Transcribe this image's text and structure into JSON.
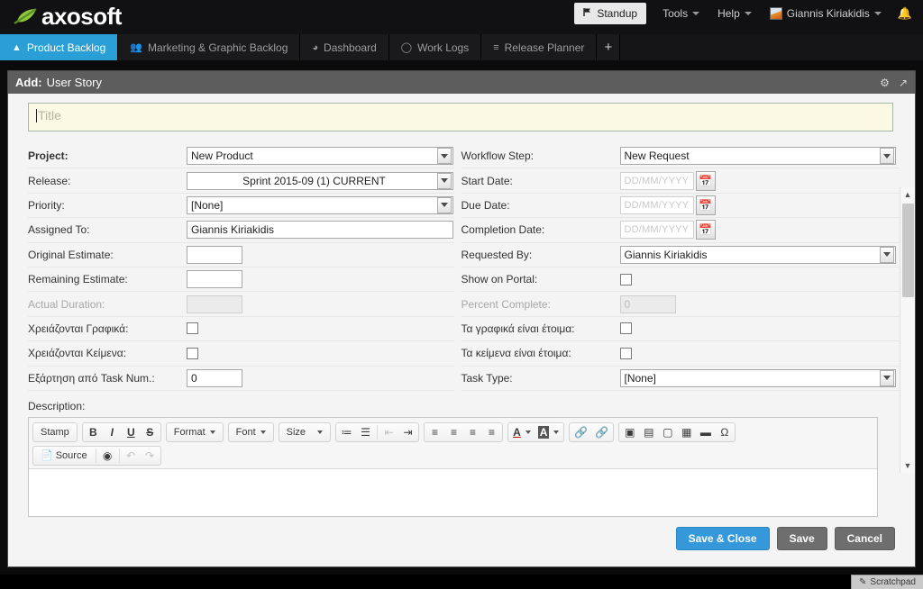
{
  "brand": {
    "name": "axosoft",
    "leaf_icon": "leaf-icon"
  },
  "topnav": {
    "standup": {
      "label": "Standup",
      "icon": "flag-icon"
    },
    "tools": {
      "label": "Tools",
      "icon": "chevron-down-icon"
    },
    "help": {
      "label": "Help",
      "icon": "chevron-down-icon"
    },
    "user": {
      "label": "Giannis Kiriakidis",
      "icon": "avatar-icon"
    },
    "notifications_icon": "bell-icon"
  },
  "tabs": [
    {
      "label": "Product Backlog",
      "icon": "people-icon",
      "active": true
    },
    {
      "label": "Marketing & Graphic Backlog",
      "icon": "people-icon",
      "active": false
    },
    {
      "label": "Dashboard",
      "icon": "gauge-icon",
      "active": false
    },
    {
      "label": "Work Logs",
      "icon": "clock-icon",
      "active": false
    },
    {
      "label": "Release Planner",
      "icon": "sliders-icon",
      "active": false
    }
  ],
  "tab_add_label": "+",
  "dialog": {
    "title_prefix": "Add:",
    "title_text": "User Story",
    "settings_icon": "gear-icon",
    "popout_icon": "popout-arrow-icon",
    "title_field": {
      "placeholder": "Title",
      "value": ""
    }
  },
  "form": {
    "left": [
      {
        "label": "Project:",
        "bold": true,
        "type": "select",
        "value": "New Product",
        "align": "left"
      },
      {
        "label": "Release:",
        "bold": false,
        "type": "select",
        "value": "Sprint 2015-09 (1) CURRENT",
        "align": "center"
      },
      {
        "label": "Priority:",
        "bold": false,
        "type": "select",
        "value": "[None]",
        "align": "left"
      },
      {
        "label": "Assigned To:",
        "bold": false,
        "type": "text-wide",
        "value": "Giannis Kiriakidis"
      },
      {
        "label": "Original Estimate:",
        "bold": false,
        "type": "text-small",
        "value": ""
      },
      {
        "label": "Remaining Estimate:",
        "bold": false,
        "type": "text-small",
        "value": ""
      },
      {
        "label": "Actual Duration:",
        "bold": false,
        "disabled": true,
        "type": "text-small-disabled",
        "value": ""
      },
      {
        "label": "Χρειάζονται Γραφικά:",
        "bold": false,
        "type": "checkbox",
        "checked": false
      },
      {
        "label": "Χρειάζονται Κείμενα:",
        "bold": false,
        "type": "checkbox",
        "checked": false
      },
      {
        "label": "Εξάρτηση από Task Num.:",
        "bold": false,
        "type": "text-small",
        "value": "0"
      }
    ],
    "right": [
      {
        "label": "Workflow Step:",
        "bold": false,
        "type": "select",
        "value": "New Request",
        "align": "left"
      },
      {
        "label": "Start Date:",
        "bold": false,
        "type": "date",
        "value": "",
        "placeholder": "DD/MM/YYYY",
        "icon": "calendar-icon"
      },
      {
        "label": "Due Date:",
        "bold": false,
        "type": "date",
        "value": "",
        "placeholder": "DD/MM/YYYY",
        "icon": "calendar-icon"
      },
      {
        "label": "Completion Date:",
        "bold": false,
        "type": "date",
        "value": "",
        "placeholder": "DD/MM/YYYY",
        "icon": "calendar-icon"
      },
      {
        "label": "Requested By:",
        "bold": false,
        "type": "select",
        "value": "Giannis Kiriakidis",
        "align": "left"
      },
      {
        "label": "Show on Portal:",
        "bold": false,
        "type": "checkbox",
        "checked": false
      },
      {
        "label": "Percent Complete:",
        "bold": false,
        "disabled": true,
        "type": "text-small-disabled",
        "value": "0"
      },
      {
        "label": "Τα γραφικά είναι έτοιμα:",
        "bold": false,
        "type": "checkbox",
        "checked": false
      },
      {
        "label": "Τα κείμενα είναι έτοιμα:",
        "bold": false,
        "type": "checkbox",
        "checked": false
      },
      {
        "label": "Task Type:",
        "bold": false,
        "type": "select",
        "value": "[None]",
        "align": "left"
      }
    ]
  },
  "description": {
    "label": "Description:",
    "body_value": "",
    "toolbar_row1": [
      {
        "name": "stamp-button",
        "label": "Stamp",
        "kind": "text",
        "disabled": false
      },
      {
        "name": "bold-button",
        "label": "B",
        "kind": "bold",
        "disabled": false
      },
      {
        "name": "italic-button",
        "label": "I",
        "kind": "italic",
        "disabled": false
      },
      {
        "name": "underline-button",
        "label": "U",
        "kind": "underline",
        "disabled": false
      },
      {
        "name": "strikethrough-button",
        "label": "S",
        "kind": "strike",
        "disabled": false
      },
      {
        "name": "format-dropdown",
        "label": "Format",
        "kind": "dropdown",
        "disabled": false
      },
      {
        "name": "font-dropdown",
        "label": "Font",
        "kind": "dropdown",
        "disabled": false
      },
      {
        "name": "size-dropdown",
        "label": "Size",
        "kind": "dropdown",
        "disabled": false
      },
      {
        "name": "numbered-list-button",
        "label": "≔",
        "kind": "icon",
        "disabled": false
      },
      {
        "name": "bulleted-list-button",
        "label": "☰",
        "kind": "icon",
        "disabled": false
      },
      {
        "name": "outdent-button",
        "label": "⇤",
        "kind": "icon",
        "disabled": true
      },
      {
        "name": "indent-button",
        "label": "⇥",
        "kind": "icon",
        "disabled": false
      },
      {
        "name": "align-left-button",
        "label": "≡",
        "kind": "icon",
        "disabled": false
      },
      {
        "name": "align-center-button",
        "label": "≡",
        "kind": "icon",
        "disabled": false
      },
      {
        "name": "align-right-button",
        "label": "≡",
        "kind": "icon",
        "disabled": false
      },
      {
        "name": "justify-button",
        "label": "≡",
        "kind": "icon",
        "disabled": false
      },
      {
        "name": "text-color-button",
        "label": "A",
        "kind": "colordrop",
        "disabled": false
      },
      {
        "name": "background-color-button",
        "label": "A",
        "kind": "colordrop2",
        "disabled": false
      },
      {
        "name": "link-button",
        "label": "🔗",
        "kind": "icon",
        "disabled": false
      },
      {
        "name": "unlink-button",
        "label": "🔗",
        "kind": "icon",
        "disabled": true
      },
      {
        "name": "insert-flash-button",
        "label": "▣",
        "kind": "icon",
        "disabled": false
      },
      {
        "name": "insert-image-button",
        "label": "▤",
        "kind": "icon",
        "disabled": false
      },
      {
        "name": "page-break-button",
        "label": "▢",
        "kind": "icon",
        "disabled": false
      },
      {
        "name": "insert-table-button",
        "label": "▦",
        "kind": "icon",
        "disabled": false
      },
      {
        "name": "horizontal-rule-button",
        "label": "▬",
        "kind": "icon",
        "disabled": false
      },
      {
        "name": "special-character-button",
        "label": "Ω",
        "kind": "icon",
        "disabled": false
      }
    ],
    "toolbar_row2": [
      {
        "name": "source-button",
        "label": "Source",
        "kind": "text",
        "disabled": false
      },
      {
        "name": "spellcheck-button",
        "label": "◉",
        "kind": "icon",
        "disabled": false
      },
      {
        "name": "undo-button",
        "label": "↶",
        "kind": "icon",
        "disabled": true
      },
      {
        "name": "redo-button",
        "label": "↷",
        "kind": "icon",
        "disabled": true
      }
    ]
  },
  "footer": {
    "save_close_label": "Save & Close",
    "save_label": "Save",
    "cancel_label": "Cancel"
  },
  "scratchpad": {
    "label": "Scratchpad",
    "icon": "pencil-icon"
  },
  "colors": {
    "accent_blue": "#2a9fd6",
    "primary_button": "#3498db",
    "grey_button": "#6e6e6e",
    "title_field_bg": "#fbf8e3",
    "dialog_header": "#5d5d5d",
    "topbar": "#111113"
  }
}
